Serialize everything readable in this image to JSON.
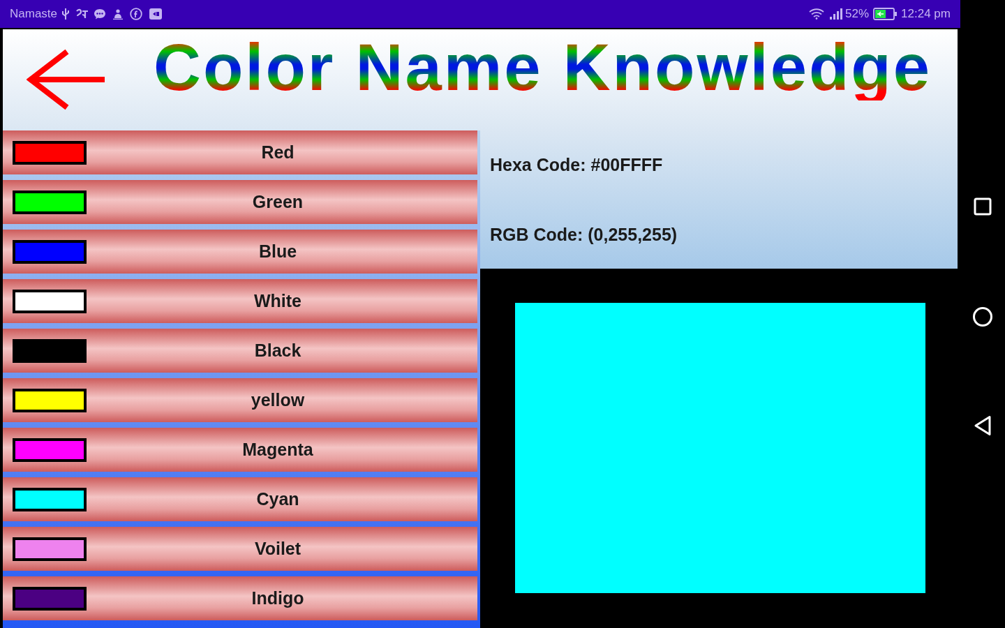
{
  "status_bar": {
    "label": "Namaste",
    "battery": "52%",
    "time": "12:24 pm"
  },
  "header": {
    "title": "Color Name Knowledge"
  },
  "colors": [
    {
      "name": "Red",
      "color": "#ff0000"
    },
    {
      "name": "Green",
      "color": "#00ff00"
    },
    {
      "name": "Blue",
      "color": "#0000ff"
    },
    {
      "name": "White",
      "color": "#ffffff"
    },
    {
      "name": "Black",
      "color": "#000000"
    },
    {
      "name": "yellow",
      "color": "#ffff00"
    },
    {
      "name": "Magenta",
      "color": "#ff00ff"
    },
    {
      "name": "Cyan",
      "color": "#00ffff"
    },
    {
      "name": "Voilet",
      "color": "#ee82ee"
    },
    {
      "name": "Indigo",
      "color": "#4b0082"
    }
  ],
  "info": {
    "hex_code": "Hexa Code: #00FFFF",
    "rgb_code": "RGB Code: (0,255,255)"
  },
  "preview": {
    "color": "#00ffff"
  }
}
